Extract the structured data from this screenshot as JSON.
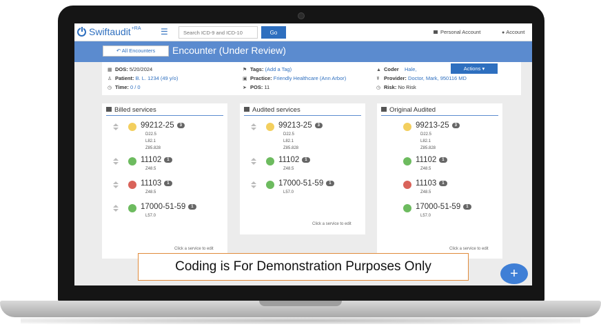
{
  "app": {
    "logo_text": "Swiftaudit",
    "logo_sup": "+RA",
    "search_placeholder": "Search ICD-9 and ICD-10",
    "go_label": "Go",
    "personal_account": "Personal Account",
    "account": "Account"
  },
  "header": {
    "back_label": "All Encounters",
    "title": "Encounter (Under Review)"
  },
  "info": {
    "dos_label": "DOS:",
    "dos_value": "5/20/2024",
    "patient_label": "Patient:",
    "patient_value": "B. L. 1234 (49 y/o)",
    "time_label": "Time:",
    "time_value": "0 / 0",
    "tags_label": "Tags:",
    "tags_value": "(Add a Tag)",
    "practice_label": "Practice:",
    "practice_value": "Friendly Healthcare (Ann Arbor)",
    "pos_label": "POS:",
    "pos_value": "11",
    "coder_label": "Coder",
    "coder_value": "Hale,",
    "provider_label": "Provider:",
    "provider_value": "Doctor, Mark, 950116 MD",
    "risk_label": "Risk:",
    "risk_value": "No Risk",
    "actions_label": "Actions ▾"
  },
  "columns": [
    {
      "title": "Billed services",
      "hint": "Click a service to edit",
      "services": [
        {
          "code": "99212-25",
          "count": "3",
          "status": "#f3cf5e",
          "dx": [
            "D22.5",
            "L82.1",
            "Z85.828"
          ]
        },
        {
          "code": "11102",
          "count": "1",
          "status": "#6dbb5f",
          "dx": [
            "Z48.5"
          ]
        },
        {
          "code": "11103",
          "count": "1",
          "status": "#d9635a",
          "dx": [
            "Z48.5"
          ]
        },
        {
          "code": "17000-51-59",
          "count": "1",
          "status": "#6dbb5f",
          "dx": [
            "L57.0"
          ]
        }
      ]
    },
    {
      "title": "Audited services",
      "hint": "Click a service to edit",
      "services": [
        {
          "code": "99213-25",
          "count": "3",
          "status": "#f3cf5e",
          "dx": [
            "D22.5",
            "L82.1",
            "Z85.828"
          ]
        },
        {
          "code": "11102",
          "count": "1",
          "status": "#6dbb5f",
          "dx": [
            "Z48.5"
          ]
        },
        {
          "code": "17000-51-59",
          "count": "1",
          "status": "#6dbb5f",
          "dx": [
            "L57.0"
          ]
        }
      ]
    },
    {
      "title": "Original Audited",
      "hint": "Click a service to edit",
      "services": [
        {
          "code": "99213-25",
          "count": "3",
          "status": "#f3cf5e",
          "dx": [
            "D22.5",
            "L82.1",
            "Z85.828"
          ]
        },
        {
          "code": "11102",
          "count": "1",
          "status": "#6dbb5f",
          "dx": [
            "Z48.5"
          ]
        },
        {
          "code": "11103",
          "count": "1",
          "status": "#d9635a",
          "dx": [
            "Z48.5"
          ]
        },
        {
          "code": "17000-51-59",
          "count": "1",
          "status": "#6dbb5f",
          "dx": [
            "L57.0"
          ]
        }
      ]
    }
  ],
  "demo_note": "Coding is For Demonstration Purposes Only",
  "fab_label": "+"
}
